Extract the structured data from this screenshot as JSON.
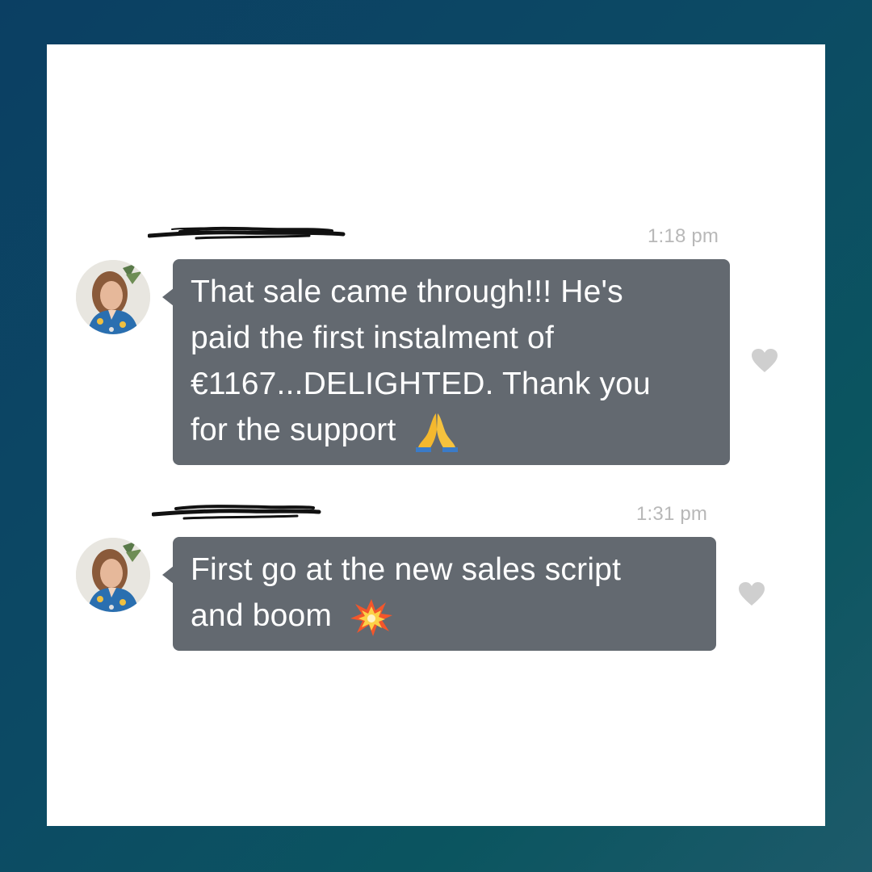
{
  "colors": {
    "bubble": "#636970",
    "timestamp": "#b8b8b8",
    "heart": "#cfcfcf",
    "background": "#0c4a64"
  },
  "messages": [
    {
      "sender": "",
      "time": "1:18 pm",
      "lines": [
        "That sale came through!!! He's",
        "paid the first instalment of",
        "€1167...DELIGHTED.  Thank you",
        "for the support"
      ],
      "emoji": "praying-hands-icon"
    },
    {
      "sender": "",
      "time": "1:31 pm",
      "lines": [
        "First go at the new sales script",
        "and boom"
      ],
      "emoji": "collision-icon"
    }
  ]
}
